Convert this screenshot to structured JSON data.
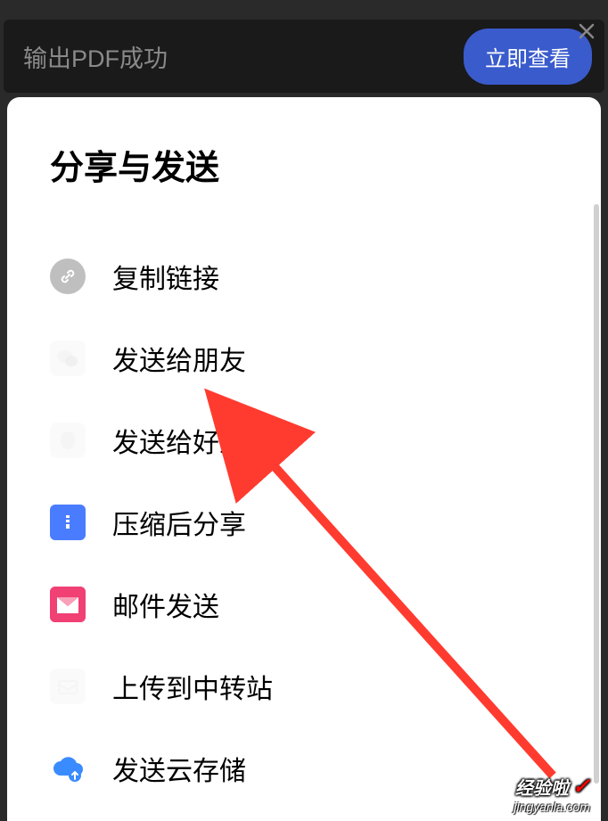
{
  "toast": {
    "message": "输出PDF成功",
    "button": "立即查看"
  },
  "sheet": {
    "title": "分享与发送",
    "items": [
      {
        "label": "复制链接",
        "icon": "link"
      },
      {
        "label": "发送给朋友",
        "icon": "wechat"
      },
      {
        "label": "发送给好友",
        "icon": "qq"
      },
      {
        "label": "压缩后分享",
        "icon": "zip"
      },
      {
        "label": "邮件发送",
        "icon": "mail"
      },
      {
        "label": "上传到中转站",
        "icon": "upload"
      },
      {
        "label": "发送云存储",
        "icon": "cloud"
      }
    ]
  },
  "watermark": {
    "brand": "经验啦",
    "url": "jingyanla.com"
  }
}
